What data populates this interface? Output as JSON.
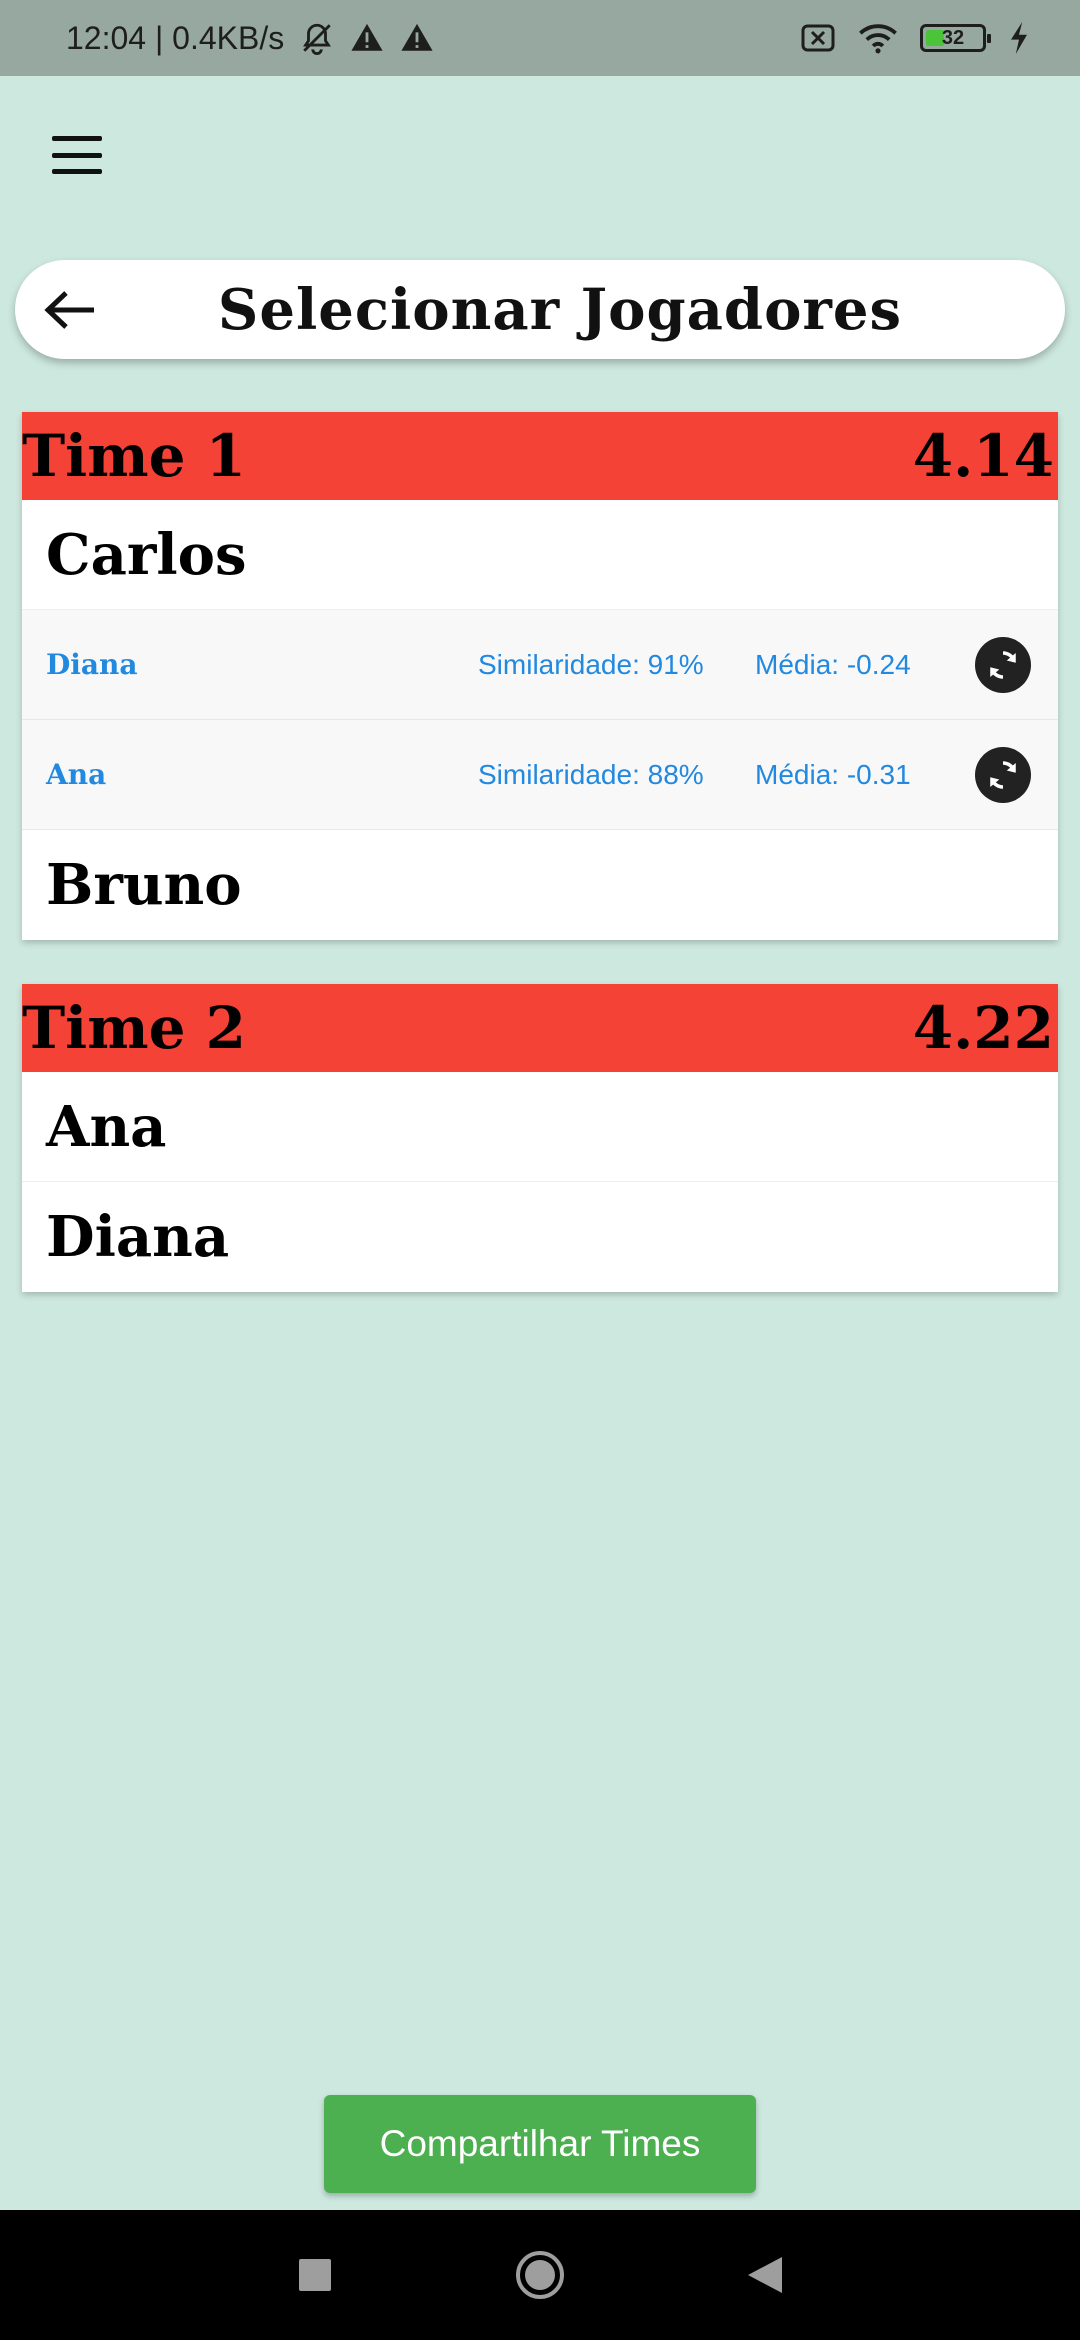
{
  "status_bar": {
    "time_speed": "12:04 | 0.4KB/s",
    "battery": "32",
    "icons": [
      "bell-off-icon",
      "warning-icon",
      "warning-icon",
      "sim-x-icon",
      "wifi-icon",
      "battery-icon",
      "charging-icon"
    ]
  },
  "header": {
    "title": "Selecionar Jogadores"
  },
  "teams": [
    {
      "name": "Time 1",
      "score": "4.14",
      "player_1": "Carlos",
      "suggestions": [
        {
          "name": "Diana",
          "similarity": "Similaridade: 91%",
          "average": "Média: -0.24"
        },
        {
          "name": "Ana",
          "similarity": "Similaridade: 88%",
          "average": "Média: -0.31"
        }
      ],
      "player_2": "Bruno"
    },
    {
      "name": "Time 2",
      "score": "4.22",
      "players": [
        "Ana",
        "Diana"
      ]
    }
  ],
  "share_button": "Compartilhar Times",
  "colors": {
    "background": "#cde8df",
    "team_header": "#f44336",
    "suggestion_text": "#2289e0",
    "share_button": "#4caf50"
  }
}
